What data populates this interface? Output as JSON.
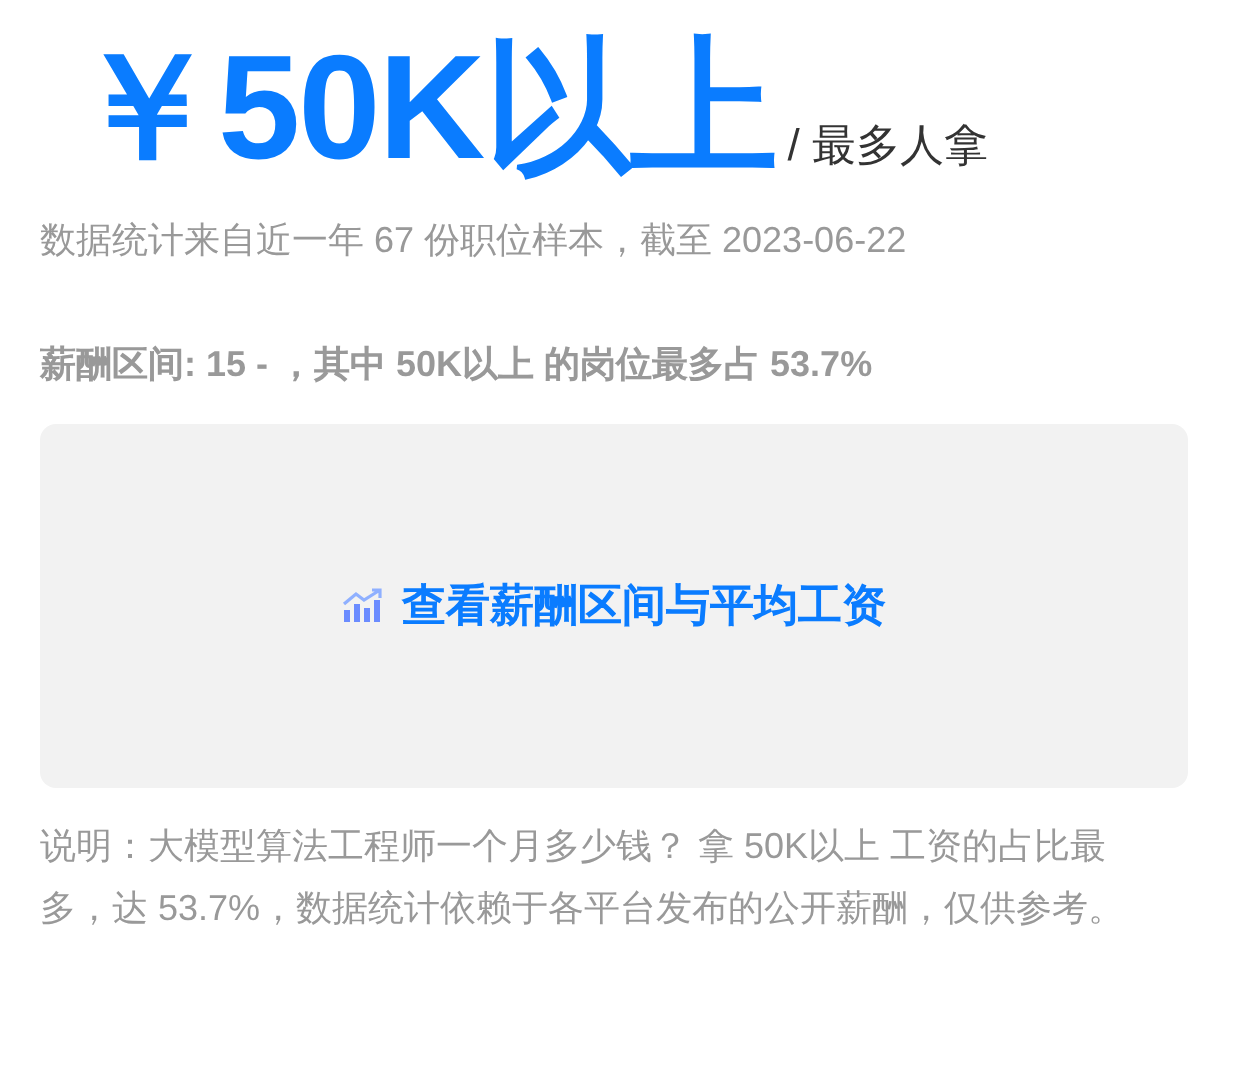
{
  "headline": {
    "amount": "￥50K以上",
    "suffix": "/ 最多人拿"
  },
  "source_note": "数据统计来自近一年 67 份职位样本，截至 2023-06-22",
  "range_summary": "薪酬区间: 15 - ，其中 50K以上 的岗位最多占 53.7%",
  "salary_button": {
    "label": "查看薪酬区间与平均工资"
  },
  "description": "说明：大模型算法工程师一个月多少钱？ 拿 50K以上 工资的占比最多，达 53.7%，数据统计依赖于各平台发布的公开薪酬，仅供参考。"
}
